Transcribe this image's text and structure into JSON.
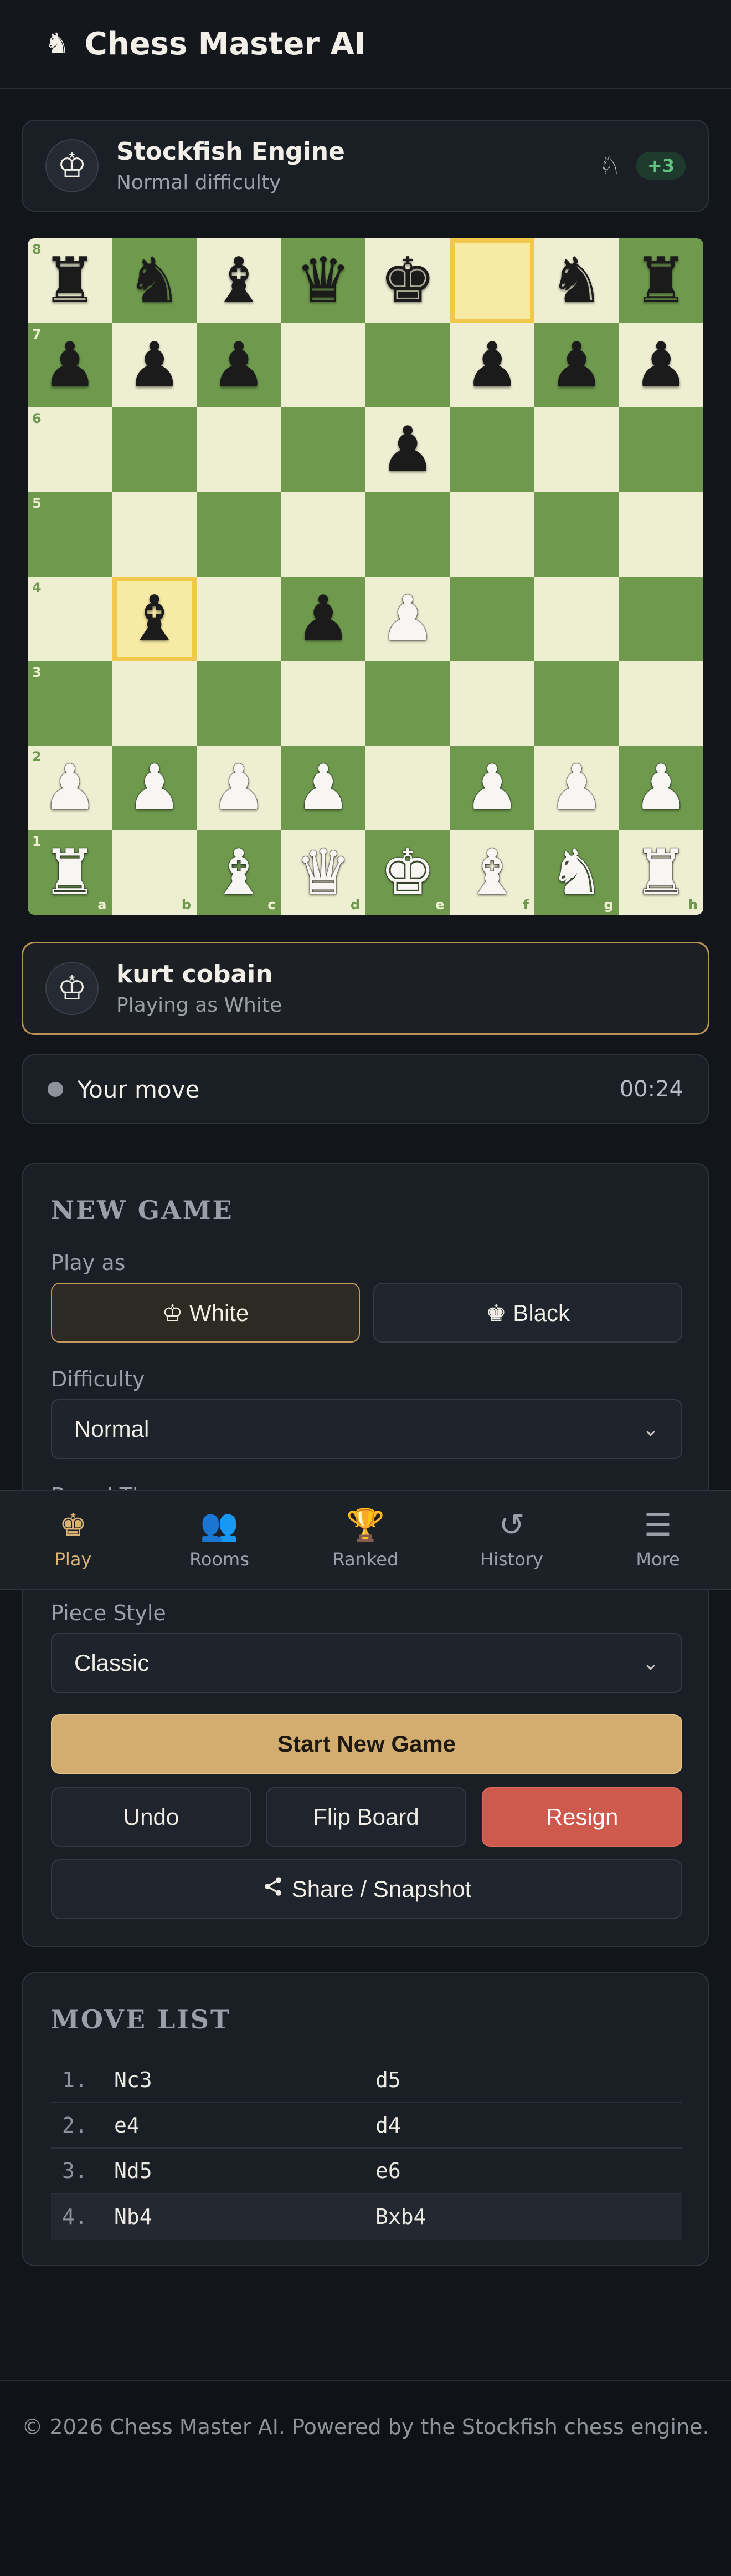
{
  "header": {
    "logo_icon": "♞",
    "title": "Chess Master AI"
  },
  "opponent": {
    "avatar_icon": "♔",
    "name": "Stockfish Engine",
    "subtitle": "Normal difficulty",
    "captured_icon": "♘",
    "material_badge": "+3"
  },
  "board": {
    "rows": [
      [
        "bR",
        "bN",
        "bB",
        "bQ",
        "bK",
        "",
        "bN",
        "bR"
      ],
      [
        "bP",
        "bP",
        "bP",
        "",
        "",
        "bP",
        "bP",
        "bP"
      ],
      [
        "",
        "",
        "",
        "",
        "bP",
        "",
        "",
        ""
      ],
      [
        "",
        "",
        "",
        "",
        "",
        "",
        "",
        ""
      ],
      [
        "",
        "bB",
        "",
        "bP",
        "wP",
        "",
        "",
        ""
      ],
      [
        "",
        "",
        "",
        "",
        "",
        "",
        "",
        ""
      ],
      [
        "wP",
        "wP",
        "wP",
        "wP",
        "",
        "wP",
        "wP",
        "wP"
      ],
      [
        "wR",
        "",
        "wB",
        "wQ",
        "wK",
        "wB",
        "wN",
        "wR"
      ]
    ],
    "highlights": [
      "f8",
      "b4"
    ],
    "rank_labels": [
      "8",
      "7",
      "6",
      "5",
      "4",
      "3",
      "2",
      "1"
    ],
    "file_labels": [
      "a",
      "b",
      "c",
      "d",
      "e",
      "f",
      "g",
      "h"
    ],
    "light_color": "#eeeed2",
    "dark_color": "#6f9a4e",
    "highlight_color": "#f1c84b"
  },
  "player": {
    "avatar_icon": "♔",
    "name": "kurt cobain",
    "subtitle": "Playing as White"
  },
  "status": {
    "text": "Your move",
    "timer": "00:24"
  },
  "new_game": {
    "title": "NEW GAME",
    "play_as_label": "Play as",
    "white_label": "♔ White",
    "black_label": "♚ Black",
    "difficulty_label": "Difficulty",
    "difficulty_value": "Normal",
    "board_theme_label": "Board Theme",
    "piece_style_label": "Piece Style",
    "piece_style_value": "Classic",
    "start_label": "Start New Game",
    "undo_label": "Undo",
    "flip_label": "Flip Board",
    "resign_label": "Resign",
    "share_label": "Share / Snapshot"
  },
  "nav": [
    {
      "icon": "♚",
      "label": "Play",
      "active": true
    },
    {
      "icon": "👥",
      "label": "Rooms",
      "active": false
    },
    {
      "icon": "🏆",
      "label": "Ranked",
      "active": false
    },
    {
      "icon": "↺",
      "label": "History",
      "active": false
    },
    {
      "icon": "☰",
      "label": "More",
      "active": false
    }
  ],
  "move_list": {
    "title": "MOVE LIST",
    "moves": [
      {
        "num": "1.",
        "white": "Nc3",
        "black": "d5"
      },
      {
        "num": "2.",
        "white": "e4",
        "black": "d4"
      },
      {
        "num": "3.",
        "white": "Nd5",
        "black": "e6"
      },
      {
        "num": "4.",
        "white": "Nb4",
        "black": "Bxb4"
      }
    ]
  },
  "footer": {
    "text": "© 2026 Chess Master AI. Powered by the Stockfish chess engine."
  },
  "colors": {
    "accent": "#d3ad6f",
    "danger": "#cd5a4c",
    "badge": "#5fc47e"
  }
}
